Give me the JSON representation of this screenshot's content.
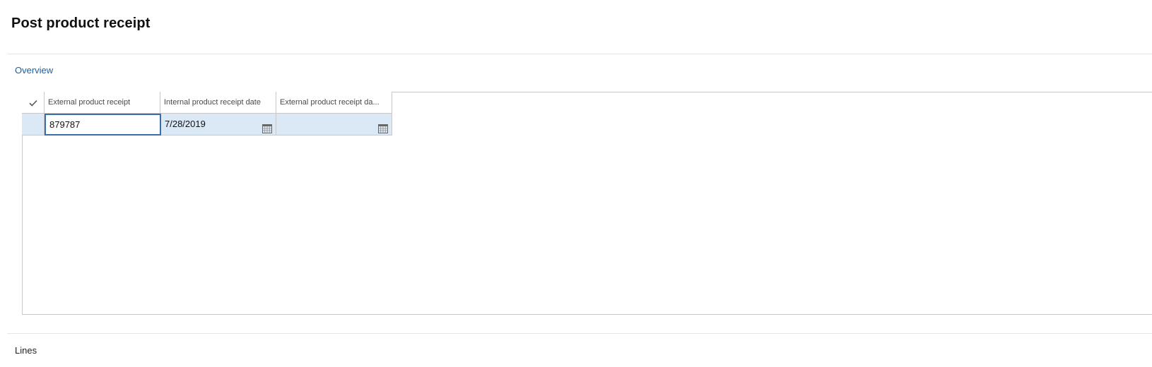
{
  "page": {
    "title": "Post product receipt"
  },
  "sections": {
    "overview_label": "Overview",
    "lines_label": "Lines"
  },
  "grid": {
    "columns": [
      {
        "key": "check",
        "label": "",
        "icon": "checkmark-icon"
      },
      {
        "key": "external_product_receipt",
        "label": "External product receipt"
      },
      {
        "key": "internal_product_receipt_date",
        "label": "Internal product receipt date"
      },
      {
        "key": "external_product_receipt_date",
        "label": "External product receipt da..."
      }
    ],
    "rows": [
      {
        "external_product_receipt": "879787",
        "internal_product_receipt_date": "7/28/2019",
        "external_product_receipt_date": ""
      }
    ],
    "selected_row_color": "#dbe9f7",
    "focus_border_color": "#3a6ea5"
  },
  "colors": {
    "accent": "#1a61a8"
  }
}
